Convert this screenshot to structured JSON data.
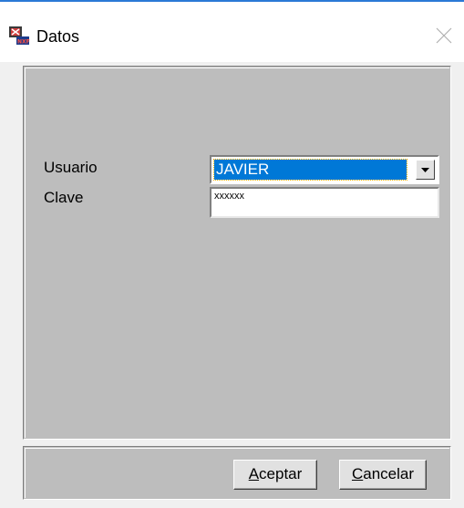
{
  "window": {
    "title": "Datos",
    "app_icon": "nxf-app-icon",
    "close_icon": "close-icon"
  },
  "form": {
    "usuario_label": "Usuario",
    "clave_label": "Clave",
    "usuario_value": "JAVIER",
    "clave_value": "xxxxxx",
    "dropdown_icon": "chevron-down-icon"
  },
  "buttons": {
    "accept": {
      "mnemonic": "A",
      "rest": "ceptar"
    },
    "cancel": {
      "mnemonic": "C",
      "rest": "ancelar"
    }
  },
  "colors": {
    "accent": "#2b79d6",
    "selection": "#0078d7",
    "panel": "#bdbdbd"
  }
}
